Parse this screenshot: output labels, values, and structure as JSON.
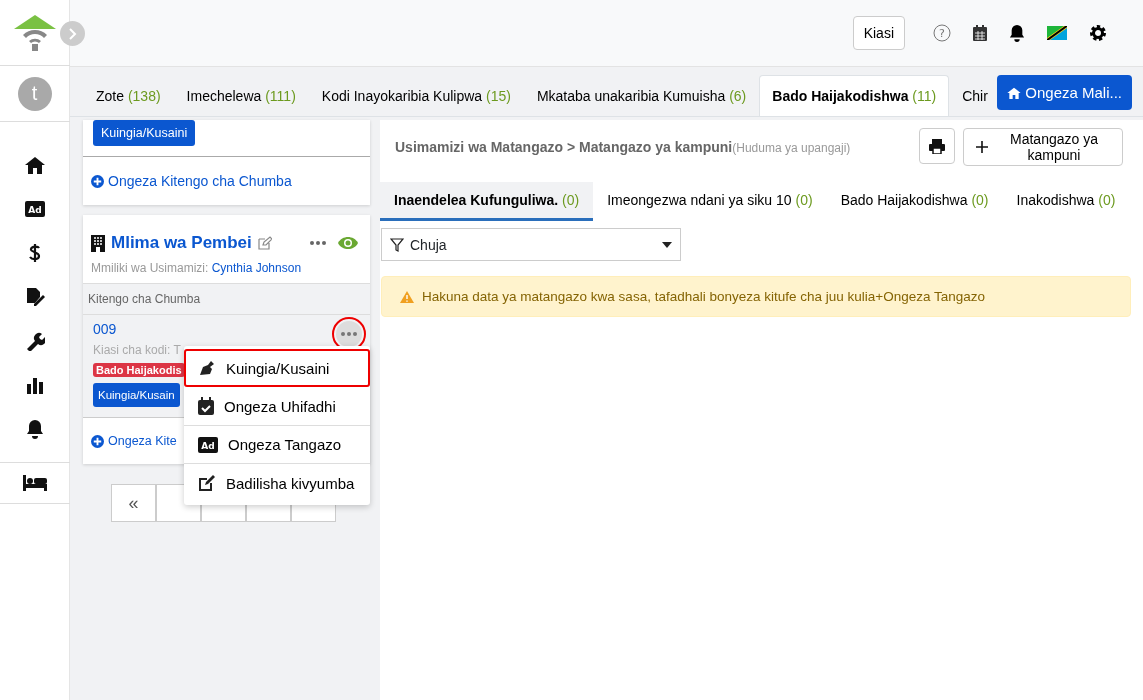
{
  "header": {
    "amount_button": "Kiasi",
    "help_icon": "?"
  },
  "sidebar": {
    "avatar": "t",
    "items": [
      {
        "kind": "home"
      },
      {
        "kind": "ad",
        "icon_text": "Ad"
      },
      {
        "kind": "dollar"
      },
      {
        "kind": "sign"
      },
      {
        "kind": "wrench"
      },
      {
        "kind": "chart"
      },
      {
        "kind": "bell"
      },
      {
        "kind": "bed"
      }
    ]
  },
  "tabs": [
    {
      "label": "Zote",
      "count": "(138)",
      "selected": false
    },
    {
      "label": "Imechelewa",
      "count": "(111)",
      "selected": false
    },
    {
      "label": "Kodi Inayokaribia Kulipwa",
      "count": "(15)",
      "selected": false
    },
    {
      "label": "Mkataba unakaribia Kumuisha",
      "count": "(6)",
      "selected": false
    },
    {
      "label": "Bado Haijakodishwa",
      "count": "(11)",
      "selected": true
    },
    {
      "label": "Chir",
      "selected": false
    }
  ],
  "add_property_button": "Ongeza Mali...",
  "top_card": {
    "button": "Kuingia/Kusaini",
    "add_unit": "Ongeza Kitengo cha Chumba"
  },
  "property": {
    "name": "Mlima wa Pembei",
    "owner_label": "Mmiliki wa Usimamizi:",
    "owner": "Cynthia Johnson",
    "section": "Kitengo cha Chumba",
    "unit": {
      "number": "009",
      "rent": "Kiasi cha kodi: T",
      "status": "Bado Haijakodis",
      "button": "Kuingia/Kusain"
    },
    "add_unit": "Ongeza Kite"
  },
  "pagination": {
    "first": "«"
  },
  "menu": [
    {
      "kind": "pen",
      "label": "Kuingia/Kusaini",
      "selected": true
    },
    {
      "kind": "calendar",
      "label": "Ongeza Uhifadhi",
      "selected": false
    },
    {
      "kind": "ad",
      "icon_text": "Ad",
      "label": "Ongeza Tangazo",
      "selected": false
    },
    {
      "kind": "edit",
      "label": "Badilisha kivyumba",
      "selected": false
    }
  ],
  "panel": {
    "breadcrumb": "Usimamizi wa Matangazo > Matangazo ya kampuni",
    "note": "(Huduma ya upangaji)",
    "add_button": "Matangazo ya kampuni",
    "tabs": [
      {
        "label": "Inaendelea Kufunguliwa.",
        "count": "(0)",
        "selected": true
      },
      {
        "label": "Imeongezwa ndani ya siku 10",
        "count": "(0)",
        "selected": false
      },
      {
        "label": "Bado Haijakodishwa",
        "count": "(0)",
        "selected": false
      },
      {
        "label": "Inakodishwa",
        "count": "(0)",
        "selected": false
      }
    ],
    "filter": "Chuja",
    "alert": "Hakuna data ya matangazo kwa sasa, tafadhali bonyeza kitufe cha juu kulia",
    "alert_plus": "+",
    "alert_link": "Ongeza Tangazo"
  }
}
